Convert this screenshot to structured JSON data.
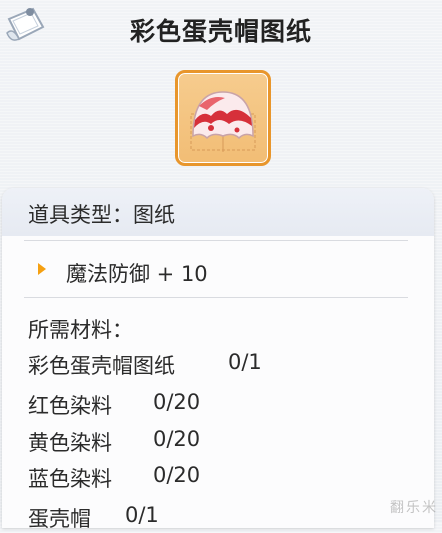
{
  "header": {
    "title": "彩色蛋壳帽图纸",
    "logo_icon": "blueprint-scroll-icon"
  },
  "item": {
    "icon": "colorful-eggshell-hat-icon",
    "frame_color": "#e8962c"
  },
  "info": {
    "item_type": "道具类型：图纸",
    "attribute": "魔法防御 + 10",
    "materials_label": "所需材料："
  },
  "materials": [
    {
      "name": "彩色蛋壳帽图纸",
      "count": "0/1"
    },
    {
      "name": "红色染料",
      "count": "0/20"
    },
    {
      "name": "黄色染料",
      "count": "0/20"
    },
    {
      "name": "蓝色染料",
      "count": "0/20"
    },
    {
      "name": "蛋壳帽",
      "count": "0/1"
    }
  ],
  "watermark": "翻乐米",
  "colors": {
    "accent": "#f5a011",
    "frame": "#e8962c"
  }
}
